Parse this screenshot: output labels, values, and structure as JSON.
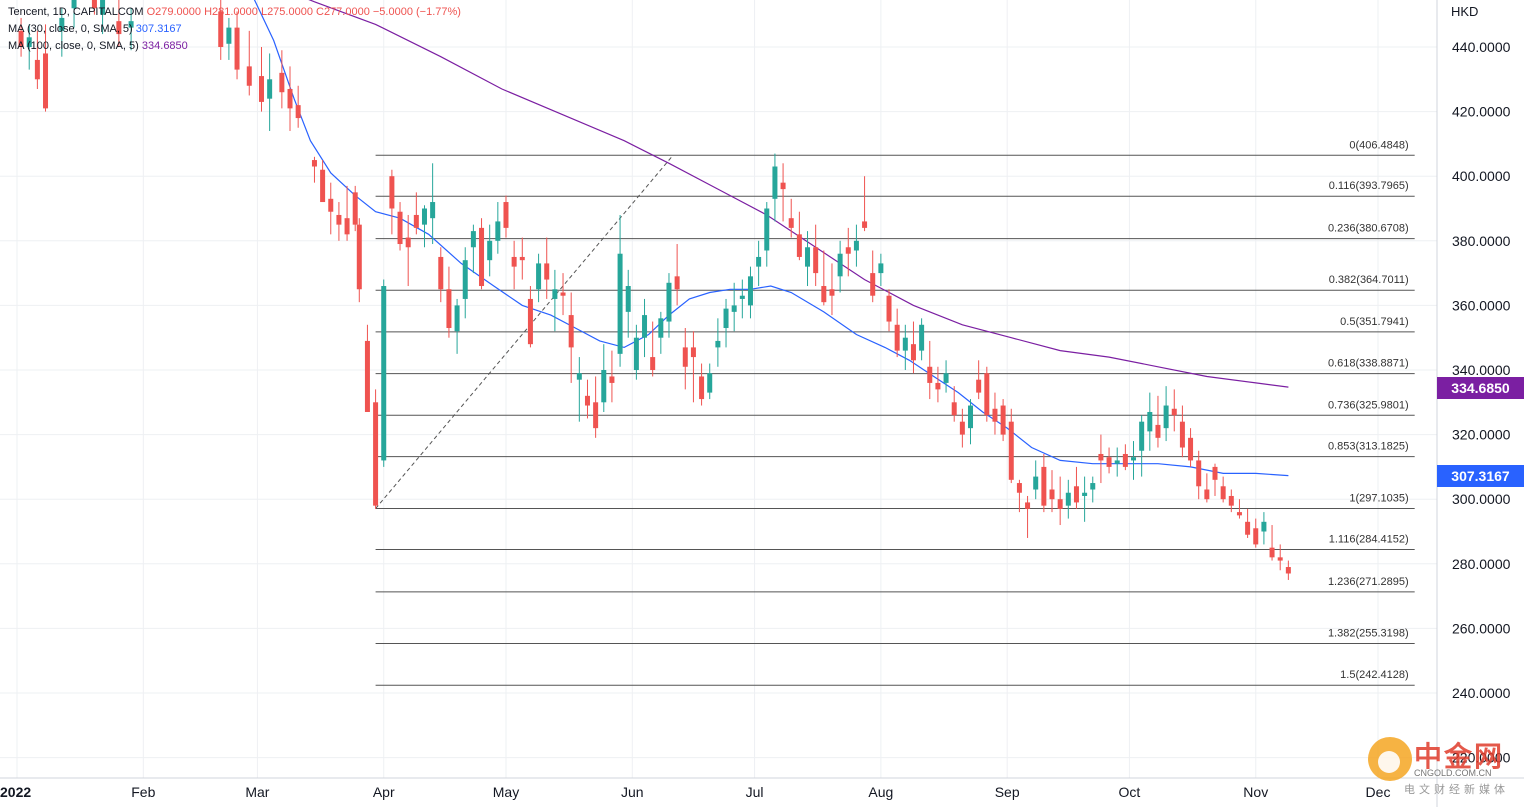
{
  "legend": {
    "main": {
      "symbol": "Tencent, 1D, CAPITALCOM",
      "ohlc": "O279.0000 H281.0000 L275.0000 C277.0000 −5.0000 (−1.77%)"
    },
    "ma30": {
      "label": "MA (30, close, 0, SMA, 5)",
      "value": "307.3167",
      "color": "#2962ff"
    },
    "ma100": {
      "label": "MA (100, close, 0, SMA, 5)",
      "value": "334.6850",
      "color": "#7b1fa2"
    }
  },
  "currency": "HKD",
  "colors": {
    "up": "#26a69a",
    "down": "#ef5350",
    "fib": "#555555",
    "grid": "#eef0f3"
  },
  "price_tags": [
    {
      "value": "334.6850",
      "color": "#7b1fa2"
    },
    {
      "value": "307.3167",
      "color": "#2962ff"
    }
  ],
  "watermark": {
    "title": "中金网",
    "domain": "CNGOLD.COM.CN",
    "sub": "电文财经新媒体"
  },
  "chart_data": {
    "type": "candlestick",
    "title": "Tencent, 1D, CAPITALCOM",
    "ylabel": "HKD",
    "ylim": [
      220,
      460
    ],
    "y_ticks": [
      "440.0000",
      "420.0000",
      "400.0000",
      "380.0000",
      "360.0000",
      "340.0000",
      "320.0000",
      "300.0000",
      "280.0000",
      "260.0000",
      "240.0000",
      "220.0000"
    ],
    "x_ticks": [
      {
        "label": "2022",
        "date": "2022-01-01"
      },
      {
        "label": "Feb",
        "date": "2022-02-01"
      },
      {
        "label": "Mar",
        "date": "2022-03-01"
      },
      {
        "label": "Apr",
        "date": "2022-04-01"
      },
      {
        "label": "May",
        "date": "2022-05-01"
      },
      {
        "label": "Jun",
        "date": "2022-06-01"
      },
      {
        "label": "Jul",
        "date": "2022-07-01"
      },
      {
        "label": "Aug",
        "date": "2022-08-01"
      },
      {
        "label": "Sep",
        "date": "2022-09-01"
      },
      {
        "label": "Oct",
        "date": "2022-10-01"
      },
      {
        "label": "Nov",
        "date": "2022-11-01"
      },
      {
        "label": "Dec",
        "date": "2022-12-01"
      }
    ],
    "x_range": [
      "2022-01-01",
      "2022-12-15"
    ],
    "candles": [
      [
        "2022-01-02",
        445,
        449,
        437,
        440
      ],
      [
        "2022-01-04",
        440,
        447,
        433,
        443
      ],
      [
        "2022-01-06",
        436,
        445,
        427,
        430
      ],
      [
        "2022-01-08",
        438,
        447,
        420,
        421
      ],
      [
        "2022-01-12",
        445,
        452,
        437,
        449
      ],
      [
        "2022-01-15",
        452,
        459,
        446,
        455
      ],
      [
        "2022-01-20",
        458,
        461,
        450,
        452
      ],
      [
        "2022-01-22",
        450,
        458,
        444,
        455
      ],
      [
        "2022-01-26",
        448,
        457,
        440,
        444
      ],
      [
        "2022-01-29",
        446,
        452,
        439,
        448
      ],
      [
        "2022-02-20",
        451,
        455,
        436,
        440
      ],
      [
        "2022-02-22",
        441,
        449,
        436,
        446
      ],
      [
        "2022-02-24",
        446,
        451,
        430,
        433
      ],
      [
        "2022-02-27",
        434,
        445,
        425,
        428
      ],
      [
        "2022-03-02",
        431,
        440,
        420,
        423
      ],
      [
        "2022-03-04",
        424,
        438,
        414,
        430
      ],
      [
        "2022-03-07",
        432,
        439,
        421,
        426
      ],
      [
        "2022-03-09",
        427,
        434,
        414,
        421
      ],
      [
        "2022-03-11",
        422,
        428,
        415,
        418
      ],
      [
        "2022-03-15",
        405,
        406,
        398,
        403
      ],
      [
        "2022-03-17",
        402,
        405,
        393,
        392
      ],
      [
        "2022-03-19",
        393,
        398,
        382,
        389
      ],
      [
        "2022-03-21",
        388,
        392,
        380,
        385
      ],
      [
        "2022-03-23",
        387,
        397,
        380,
        382
      ],
      [
        "2022-03-25",
        395,
        397,
        383,
        385
      ],
      [
        "2022-03-26",
        385,
        387,
        361,
        365
      ],
      [
        "2022-03-28",
        349,
        354,
        332,
        327
      ],
      [
        "2022-03-30",
        330,
        334,
        297,
        298
      ],
      [
        "2022-04-01",
        312,
        368,
        310,
        366
      ],
      [
        "2022-04-03",
        400,
        402,
        382,
        390
      ],
      [
        "2022-04-05",
        389,
        392,
        377,
        379
      ],
      [
        "2022-04-07",
        381,
        388,
        366,
        378
      ],
      [
        "2022-04-09",
        388,
        395,
        382,
        384
      ],
      [
        "2022-04-11",
        385,
        391,
        378,
        390
      ],
      [
        "2022-04-13",
        387,
        404,
        379,
        392
      ],
      [
        "2022-04-15",
        375,
        378,
        361,
        365
      ],
      [
        "2022-04-17",
        365,
        372,
        350,
        353
      ],
      [
        "2022-04-19",
        352,
        362,
        345,
        360
      ],
      [
        "2022-04-21",
        362,
        378,
        356,
        374
      ],
      [
        "2022-04-23",
        378,
        385,
        370,
        383
      ],
      [
        "2022-04-25",
        384,
        387,
        365,
        366
      ],
      [
        "2022-04-27",
        374,
        385,
        369,
        380
      ],
      [
        "2022-04-29",
        380,
        392,
        376,
        386
      ],
      [
        "2022-05-01",
        392,
        394,
        381,
        384
      ],
      [
        "2022-05-03",
        375,
        380,
        365,
        372
      ],
      [
        "2022-05-05",
        375,
        381,
        368,
        374
      ],
      [
        "2022-05-07",
        362,
        366,
        347,
        348
      ],
      [
        "2022-05-09",
        365,
        376,
        361,
        373
      ],
      [
        "2022-05-11",
        373,
        381,
        362,
        368
      ],
      [
        "2022-05-13",
        362,
        371,
        352,
        365
      ],
      [
        "2022-05-15",
        364,
        370,
        357,
        363
      ],
      [
        "2022-05-17",
        357,
        364,
        336,
        347
      ],
      [
        "2022-05-19",
        337,
        344,
        324,
        339
      ],
      [
        "2022-05-21",
        332,
        337,
        325,
        329
      ],
      [
        "2022-05-23",
        330,
        338,
        319,
        322
      ],
      [
        "2022-05-25",
        330,
        348,
        327,
        340
      ],
      [
        "2022-05-27",
        338,
        346,
        330,
        336
      ],
      [
        "2022-05-29",
        345,
        388,
        341,
        376
      ],
      [
        "2022-05-31",
        358,
        371,
        350,
        366
      ],
      [
        "2022-06-02",
        340,
        354,
        337,
        350
      ],
      [
        "2022-06-04",
        350,
        362,
        344,
        357
      ],
      [
        "2022-06-06",
        344,
        355,
        338,
        340
      ],
      [
        "2022-06-08",
        350,
        358,
        345,
        356
      ],
      [
        "2022-06-10",
        355,
        370,
        350,
        367
      ],
      [
        "2022-06-12",
        369,
        379,
        360,
        365
      ],
      [
        "2022-06-14",
        347,
        353,
        334,
        341
      ],
      [
        "2022-06-16",
        347,
        352,
        330,
        344
      ],
      [
        "2022-06-18",
        338,
        342,
        329,
        331
      ],
      [
        "2022-06-20",
        333,
        342,
        331,
        339
      ],
      [
        "2022-06-22",
        347,
        356,
        341,
        349
      ],
      [
        "2022-06-24",
        353,
        362,
        347,
        359
      ],
      [
        "2022-06-26",
        358,
        367,
        352,
        360
      ],
      [
        "2022-06-28",
        362,
        368,
        356,
        363
      ],
      [
        "2022-06-30",
        360,
        372,
        356,
        369
      ],
      [
        "2022-07-02",
        372,
        380,
        366,
        375
      ],
      [
        "2022-07-04",
        377,
        392,
        372,
        390
      ],
      [
        "2022-07-06",
        393,
        407,
        386,
        403
      ],
      [
        "2022-07-08",
        398,
        404,
        386,
        396
      ],
      [
        "2022-07-10",
        387,
        393,
        381,
        384
      ],
      [
        "2022-07-12",
        382,
        389,
        374,
        375
      ],
      [
        "2022-07-14",
        372,
        383,
        366,
        378
      ],
      [
        "2022-07-16",
        378,
        385,
        366,
        370
      ],
      [
        "2022-07-18",
        366,
        377,
        360,
        361
      ],
      [
        "2022-07-20",
        365,
        373,
        357,
        363
      ],
      [
        "2022-07-22",
        369,
        380,
        364,
        376
      ],
      [
        "2022-07-24",
        378,
        384,
        369,
        376
      ],
      [
        "2022-07-26",
        377,
        385,
        372,
        380
      ],
      [
        "2022-07-28",
        386,
        400,
        383,
        384
      ],
      [
        "2022-07-30",
        370,
        377,
        361,
        363
      ],
      [
        "2022-08-01",
        370,
        376,
        366,
        373
      ],
      [
        "2022-08-03",
        363,
        365,
        352,
        355
      ],
      [
        "2022-08-05",
        354,
        359,
        344,
        346
      ],
      [
        "2022-08-07",
        346,
        354,
        340,
        350
      ],
      [
        "2022-08-09",
        348,
        355,
        339,
        343
      ],
      [
        "2022-08-11",
        346,
        356,
        343,
        354
      ],
      [
        "2022-08-13",
        341,
        349,
        331,
        336
      ],
      [
        "2022-08-15",
        336,
        341,
        330,
        334
      ],
      [
        "2022-08-17",
        336,
        343,
        333,
        339
      ],
      [
        "2022-08-19",
        330,
        335,
        324,
        326
      ],
      [
        "2022-08-21",
        324,
        328,
        316,
        320
      ],
      [
        "2022-08-23",
        322,
        331,
        317,
        329
      ],
      [
        "2022-08-25",
        337,
        343,
        331,
        333
      ],
      [
        "2022-08-27",
        339,
        341,
        324,
        326
      ],
      [
        "2022-08-29",
        328,
        333,
        320,
        324
      ],
      [
        "2022-08-31",
        329,
        331,
        318,
        320
      ],
      [
        "2022-09-02",
        324,
        328,
        305,
        306
      ],
      [
        "2022-09-04",
        305,
        306,
        296,
        302
      ],
      [
        "2022-09-06",
        299,
        301,
        288,
        297
      ],
      [
        "2022-09-08",
        303,
        312,
        300,
        307
      ],
      [
        "2022-09-10",
        310,
        314,
        296,
        298
      ],
      [
        "2022-09-12",
        303,
        309,
        296,
        300
      ],
      [
        "2022-09-14",
        300,
        307,
        292,
        297
      ],
      [
        "2022-09-16",
        298,
        306,
        294,
        302
      ],
      [
        "2022-09-18",
        304,
        310,
        297,
        299
      ],
      [
        "2022-09-20",
        301,
        307,
        293,
        302
      ],
      [
        "2022-09-22",
        303,
        307,
        299,
        305
      ],
      [
        "2022-09-24",
        314,
        320,
        305,
        312
      ],
      [
        "2022-09-26",
        313,
        316,
        308,
        310
      ],
      [
        "2022-09-28",
        311,
        316,
        307,
        312
      ],
      [
        "2022-09-30",
        314,
        317,
        309,
        310
      ],
      [
        "2022-10-02",
        312,
        318,
        306,
        313
      ],
      [
        "2022-10-04",
        315,
        326,
        307,
        324
      ],
      [
        "2022-10-06",
        321,
        333,
        315,
        327
      ],
      [
        "2022-10-08",
        323,
        332,
        316,
        319
      ],
      [
        "2022-10-10",
        322,
        335,
        318,
        329
      ],
      [
        "2022-10-12",
        328,
        334,
        321,
        326
      ],
      [
        "2022-10-14",
        324,
        329,
        313,
        316
      ],
      [
        "2022-10-16",
        319,
        322,
        310,
        312
      ],
      [
        "2022-10-18",
        312,
        315,
        300,
        304
      ],
      [
        "2022-10-20",
        303,
        308,
        299,
        300
      ],
      [
        "2022-10-22",
        310,
        311,
        301,
        306
      ],
      [
        "2022-10-24",
        304,
        307,
        299,
        300
      ],
      [
        "2022-10-26",
        301,
        303,
        296,
        298
      ],
      [
        "2022-10-28",
        296,
        300,
        294,
        295
      ],
      [
        "2022-10-30",
        293,
        297,
        288,
        289
      ],
      [
        "2022-11-01",
        291,
        294,
        285,
        286
      ],
      [
        "2022-11-03",
        290,
        296,
        286,
        293
      ],
      [
        "2022-11-05",
        285,
        292,
        281,
        282
      ],
      [
        "2022-11-07",
        282,
        286,
        278,
        281
      ],
      [
        "2022-11-09",
        279,
        281,
        275,
        277
      ]
    ],
    "ma30": [
      [
        "2022-02-27",
        458
      ],
      [
        "2022-03-05",
        442
      ],
      [
        "2022-03-10",
        424
      ],
      [
        "2022-03-14",
        411
      ],
      [
        "2022-03-19",
        401
      ],
      [
        "2022-03-25",
        394
      ],
      [
        "2022-03-30",
        389
      ],
      [
        "2022-04-05",
        387
      ],
      [
        "2022-04-12",
        382
      ],
      [
        "2022-04-20",
        373
      ],
      [
        "2022-04-28",
        366
      ],
      [
        "2022-05-05",
        360
      ],
      [
        "2022-05-12",
        357
      ],
      [
        "2022-05-18",
        353
      ],
      [
        "2022-05-24",
        349
      ],
      [
        "2022-05-30",
        347
      ],
      [
        "2022-06-05",
        351
      ],
      [
        "2022-06-10",
        357
      ],
      [
        "2022-06-15",
        362
      ],
      [
        "2022-06-20",
        364
      ],
      [
        "2022-06-25",
        365
      ],
      [
        "2022-06-30",
        365
      ],
      [
        "2022-07-05",
        366
      ],
      [
        "2022-07-10",
        364
      ],
      [
        "2022-07-18",
        358
      ],
      [
        "2022-07-26",
        351
      ],
      [
        "2022-08-02",
        347
      ],
      [
        "2022-08-08",
        343
      ],
      [
        "2022-08-14",
        338
      ],
      [
        "2022-08-20",
        333
      ],
      [
        "2022-08-26",
        327
      ],
      [
        "2022-09-01",
        322
      ],
      [
        "2022-09-07",
        316
      ],
      [
        "2022-09-14",
        312
      ],
      [
        "2022-09-22",
        311
      ],
      [
        "2022-09-30",
        311
      ],
      [
        "2022-10-08",
        311
      ],
      [
        "2022-10-16",
        310
      ],
      [
        "2022-10-24",
        308
      ],
      [
        "2022-11-01",
        308
      ],
      [
        "2022-11-09",
        307.3
      ]
    ],
    "ma100": [
      [
        "2022-02-27",
        462
      ],
      [
        "2022-03-05",
        459
      ],
      [
        "2022-03-15",
        454
      ],
      [
        "2022-03-30",
        447
      ],
      [
        "2022-04-15",
        437
      ],
      [
        "2022-04-30",
        427
      ],
      [
        "2022-05-15",
        419
      ],
      [
        "2022-05-30",
        411
      ],
      [
        "2022-06-10",
        404
      ],
      [
        "2022-06-22",
        396
      ],
      [
        "2022-07-04",
        388
      ],
      [
        "2022-07-16",
        378
      ],
      [
        "2022-07-28",
        368
      ],
      [
        "2022-08-09",
        360
      ],
      [
        "2022-08-21",
        354
      ],
      [
        "2022-09-02",
        350
      ],
      [
        "2022-09-14",
        346
      ],
      [
        "2022-09-26",
        344
      ],
      [
        "2022-10-08",
        341
      ],
      [
        "2022-10-20",
        338
      ],
      [
        "2022-11-01",
        336
      ],
      [
        "2022-11-09",
        334.7
      ]
    ],
    "fib_levels": [
      {
        "label": "0(406.4848)",
        "value": 406.4848
      },
      {
        "label": "0.116(393.7965)",
        "value": 393.7965
      },
      {
        "label": "0.236(380.6708)",
        "value": 380.6708
      },
      {
        "label": "0.382(364.7011)",
        "value": 364.7011
      },
      {
        "label": "0.5(351.7941)",
        "value": 351.7941
      },
      {
        "label": "0.618(338.8871)",
        "value": 338.8871
      },
      {
        "label": "0.736(325.9801)",
        "value": 325.9801
      },
      {
        "label": "0.853(313.1825)",
        "value": 313.1825
      },
      {
        "label": "1(297.1035)",
        "value": 297.1035
      },
      {
        "label": "1.116(284.4152)",
        "value": 284.4152
      },
      {
        "label": "1.236(271.2895)",
        "value": 271.2895
      },
      {
        "label": "1.382(255.3198)",
        "value": 255.3198
      },
      {
        "label": "1.5(242.4128)",
        "value": 242.4128
      }
    ],
    "fib_anchor": {
      "start": [
        "2022-03-30",
        297.1035
      ],
      "end": [
        "2022-06-11",
        406.4848
      ],
      "line_end": "2022-12-10"
    }
  }
}
